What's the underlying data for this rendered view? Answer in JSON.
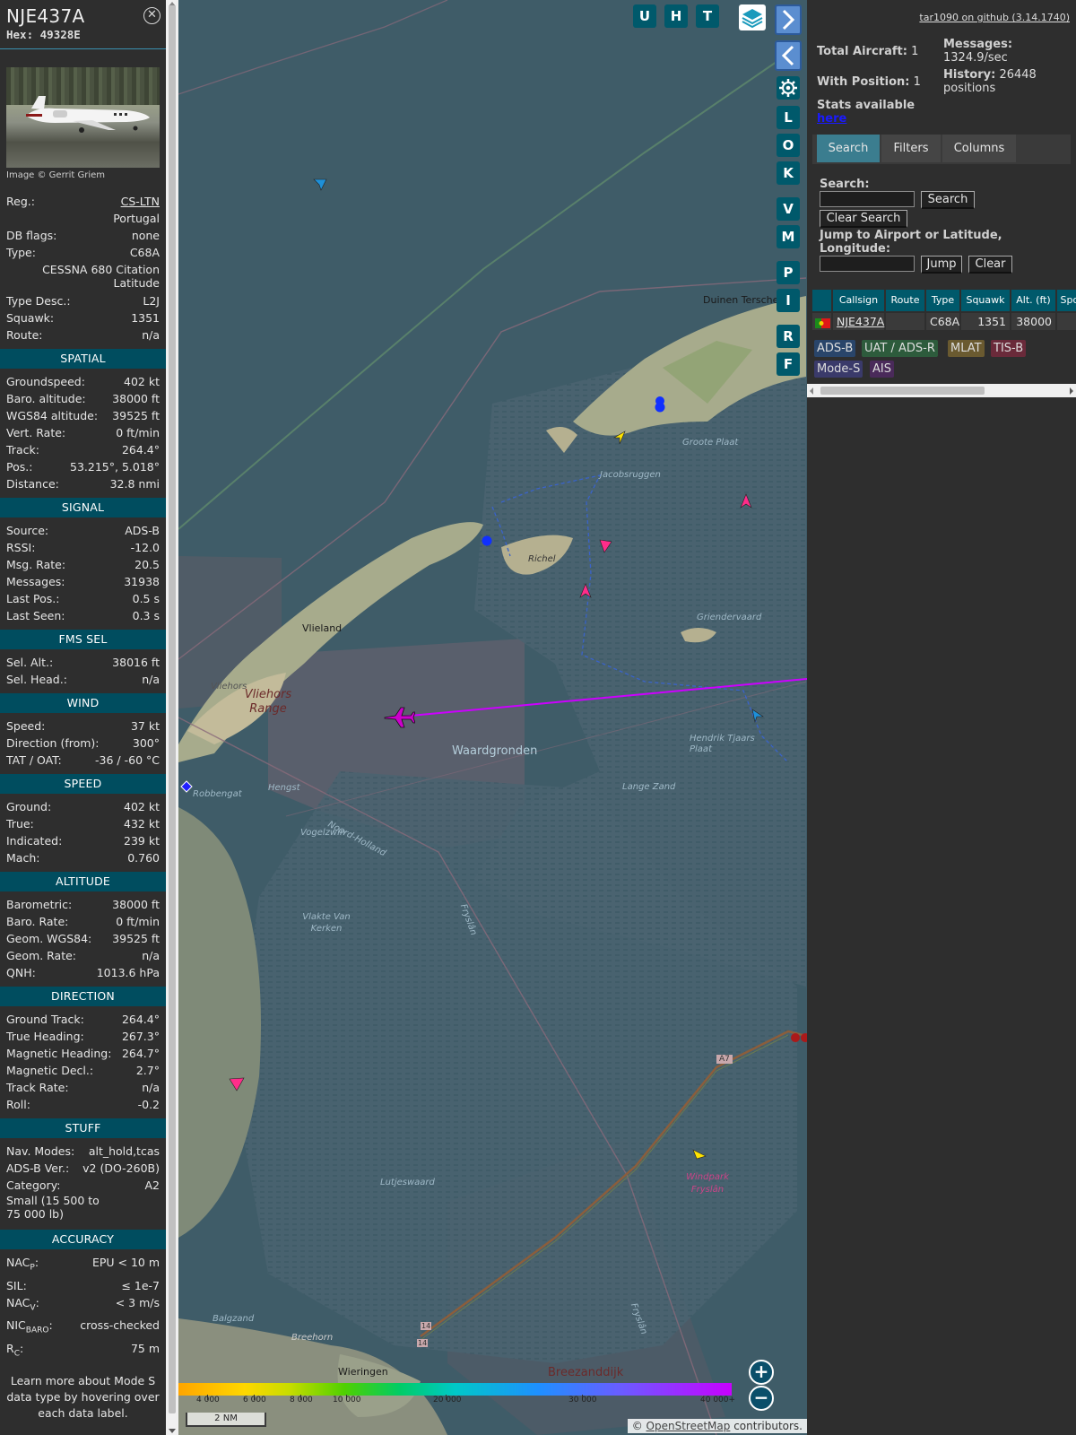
{
  "aircraft": {
    "callsign": "NJE437A",
    "hex_label": "Hex:",
    "hex": "49328E",
    "image_credit": "Image © Gerrit Griem",
    "reg_label": "Reg.:",
    "reg": "CS-LTN",
    "country": "Portugal",
    "dbflags_label": "DB flags:",
    "dbflags": "none",
    "type_label": "Type:",
    "type": "C68A",
    "type_name": "CESSNA 680 Citation Latitude",
    "typedesc_label": "Type Desc.:",
    "typedesc": "L2J",
    "squawk_label": "Squawk:",
    "squawk": "1351",
    "route_label": "Route:",
    "route": "n/a"
  },
  "sections": {
    "spatial": "SPATIAL",
    "signal": "SIGNAL",
    "fms": "FMS SEL",
    "wind": "WIND",
    "speed": "SPEED",
    "altitude": "ALTITUDE",
    "direction": "DIRECTION",
    "stuff": "STUFF",
    "accuracy": "ACCURACY"
  },
  "spatial": [
    {
      "k": "Groundspeed:",
      "v": "402 kt"
    },
    {
      "k": "Baro. altitude:",
      "v": "38000 ft"
    },
    {
      "k": "WGS84 altitude:",
      "v": "39525 ft"
    },
    {
      "k": "Vert. Rate:",
      "v": "0 ft/min"
    },
    {
      "k": "Track:",
      "v": "264.4°"
    },
    {
      "k": "Pos.:",
      "v": "53.215°, 5.018°"
    },
    {
      "k": "Distance:",
      "v": "32.8 nmi"
    }
  ],
  "signal": [
    {
      "k": "Source:",
      "v": "ADS-B"
    },
    {
      "k": "RSSI:",
      "v": "-12.0"
    },
    {
      "k": "Msg. Rate:",
      "v": "20.5"
    },
    {
      "k": "Messages:",
      "v": "31938"
    },
    {
      "k": "Last Pos.:",
      "v": "0.5 s"
    },
    {
      "k": "Last Seen:",
      "v": "0.3 s"
    }
  ],
  "fms": [
    {
      "k": "Sel. Alt.:",
      "v": "38016 ft"
    },
    {
      "k": "Sel. Head.:",
      "v": "n/a"
    }
  ],
  "wind": [
    {
      "k": "Speed:",
      "v": "37 kt"
    },
    {
      "k": "Direction (from):",
      "v": "300°"
    },
    {
      "k": "TAT / OAT:",
      "v": "-36 / -60 °C"
    }
  ],
  "speed": [
    {
      "k": "Ground:",
      "v": "402 kt"
    },
    {
      "k": "True:",
      "v": "432 kt"
    },
    {
      "k": "Indicated:",
      "v": "239 kt"
    },
    {
      "k": "Mach:",
      "v": "0.760"
    }
  ],
  "altitude": [
    {
      "k": "Barometric:",
      "v": "38000 ft"
    },
    {
      "k": "Baro. Rate:",
      "v": "0 ft/min"
    },
    {
      "k": "Geom. WGS84:",
      "v": "39525 ft"
    },
    {
      "k": "Geom. Rate:",
      "v": "n/a"
    },
    {
      "k": "QNH:",
      "v": "1013.6 hPa"
    }
  ],
  "direction": [
    {
      "k": "Ground Track:",
      "v": "264.4°"
    },
    {
      "k": "True Heading:",
      "v": "267.3°"
    },
    {
      "k": "Magnetic Heading:",
      "v": "264.7°"
    },
    {
      "k": "Magnetic Decl.:",
      "v": "2.7°"
    },
    {
      "k": "Track Rate:",
      "v": "n/a"
    },
    {
      "k": "Roll:",
      "v": "-0.2"
    }
  ],
  "stuff": [
    {
      "k": "Nav. Modes:",
      "v": "alt_hold,tcas"
    },
    {
      "k": "ADS-B Ver.:",
      "v": "v2 (DO-260B)"
    },
    {
      "k": "Category:",
      "v": "A2"
    }
  ],
  "stuff_note": "Small (15 500 to 75 000 lb)",
  "accuracy": {
    "nacp_k": "NAC",
    "nacp_sub": "P",
    "nacp_v": "EPU < 10 m",
    "sil_k": "SIL:",
    "sil_v": "≤ 1e-7",
    "nacv_k": "NAC",
    "nacv_sub": "V",
    "nacv_v": "< 3 m/s",
    "nic_k": "NIC",
    "nic_sub": "BARO",
    "nic_v": "cross-checked",
    "rc_k": "R",
    "rc_sub": "C",
    "rc_v": "75 m"
  },
  "learn_more": "Learn more about Mode S data type by hovering over each data label.",
  "map": {
    "top_buttons": [
      "U",
      "H",
      "T"
    ],
    "side_buttons": [
      "L",
      "O",
      "K",
      "V",
      "M",
      "P",
      "I",
      "R",
      "F"
    ],
    "labels": {
      "terschelling": "Duinen Terschelling",
      "groote_plaat": "Groote Plaat",
      "jacobsruggen": "Jacobsruggen",
      "richel": "Richel",
      "griend": "Griendervaard",
      "vlieland": "Vlieland",
      "vliehors": "Vliehors",
      "vliehors_range": "Vliehors Range",
      "waardgronden": "Waardgronden",
      "hendrik": "Hendrik Tjaars Plaat",
      "langezand": "Lange Zand",
      "robbengat": "Robbengat",
      "hengst": "Hengst",
      "vogelzwin": "Vogelzwin",
      "noordholland": "Noord-Holland",
      "fryslan": "Fryslân",
      "vlakte": "Vlakte Van Kerken",
      "a7": "A7",
      "windpark": "Windpark Fryslân",
      "lutjeswaard": "Lutjeswaard",
      "fryslan2": "Fryslân",
      "balgzand": "Balgzand",
      "breehorn": "Breehorn",
      "wieringen": "Wieringen",
      "breezanddijk": "Breezanddijk",
      "r14a": "14",
      "r14b": "14"
    },
    "altitude_ticks": [
      "4 000",
      "6 000",
      "8 000",
      "10 000",
      "20 000",
      "30 000",
      "40 000+"
    ],
    "scale": "2 NM",
    "attribution_prefix": "© ",
    "attribution_link": "OpenStreetMap",
    "attribution_suffix": " contributors."
  },
  "right": {
    "github": "tar1090 on github (3.14.1740)",
    "total_label": "Total Aircraft:",
    "total": "1",
    "withpos_label": "With Position:",
    "withpos": "1",
    "messages_label": "Messages:",
    "messages": "1324.9/sec",
    "history_label": "History:",
    "history": "26448 positions",
    "stats_text": "Stats available",
    "stats_link": "here",
    "tabs": [
      "Search",
      "Filters",
      "Columns"
    ],
    "search_label": "Search:",
    "search_btn": "Search",
    "clear_search_btn": "Clear Search",
    "jump_label": "Jump to Airport or Latitude, Longitude:",
    "jump_btn": "Jump",
    "clear_btn": "Clear",
    "table_headers": [
      "Callsign",
      "Route",
      "Type",
      "Squawk",
      "Alt. (ft)",
      "Spd"
    ],
    "row": {
      "callsign": "NJE437A",
      "route": "",
      "type": "C68A",
      "squawk": "1351",
      "alt": "38000",
      "spd": ""
    },
    "legend": [
      "ADS-B",
      "UAT / ADS-R",
      "MLAT",
      "TIS-B",
      "Mode-S",
      "AIS"
    ]
  },
  "colors": {
    "section_bg": "#004d5f",
    "button_bg": "#00596b",
    "track_line": "#cc00ff",
    "aircraft": "#cc00cc"
  }
}
